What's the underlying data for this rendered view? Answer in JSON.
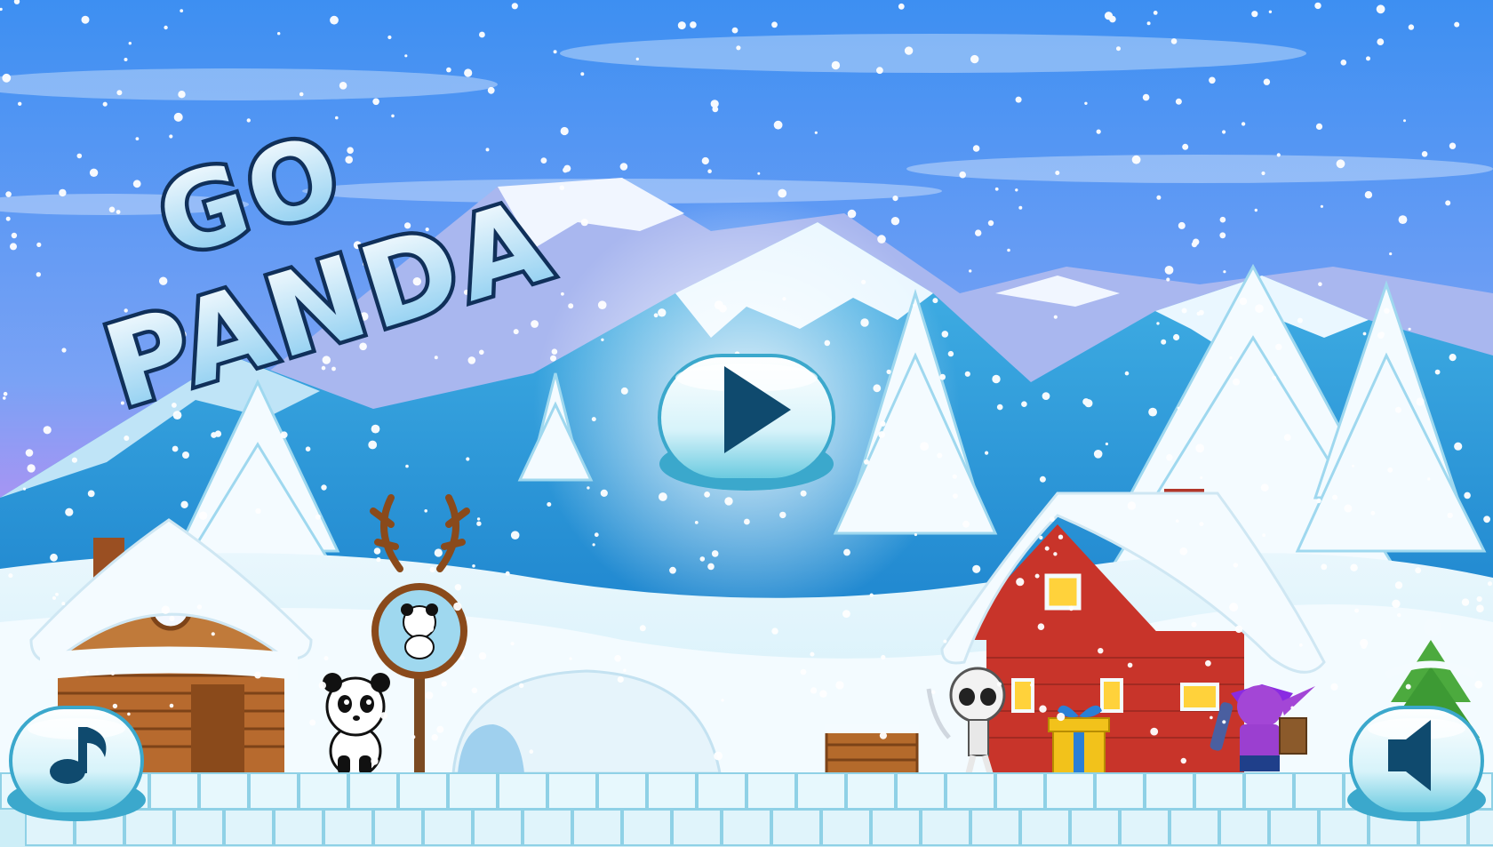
{
  "game": {
    "title_line1": "GO",
    "title_line2": "PANDA"
  },
  "buttons": {
    "play": {
      "icon": "play-icon"
    },
    "music": {
      "icon": "music-note-icon"
    },
    "sound": {
      "icon": "speaker-icon"
    }
  },
  "colors": {
    "sky_top": "#3d8ff2",
    "sky_bottom": "#d985f0",
    "snow": "#f4fbff",
    "ice": "#bfe9f5",
    "button_face": "#e6f8fc",
    "button_icon": "#0f4a6e",
    "title_fill": "#dff4ff",
    "title_stroke": "#10305a"
  }
}
